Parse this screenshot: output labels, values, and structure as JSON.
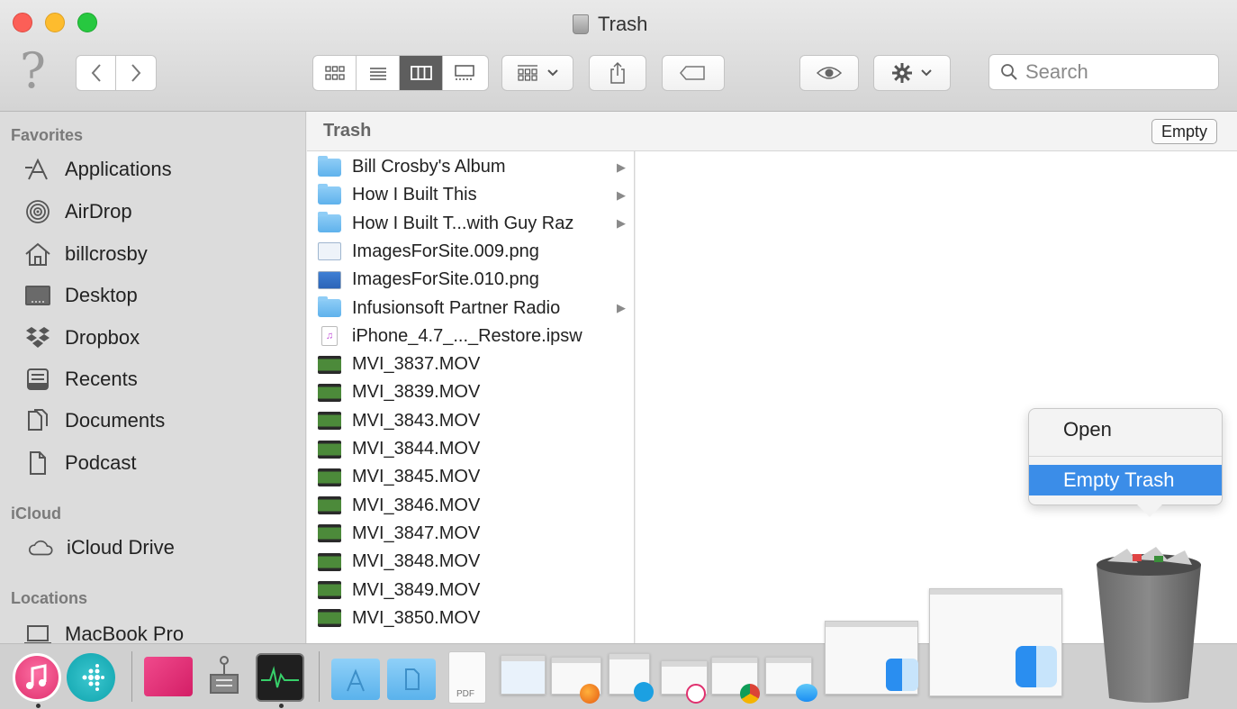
{
  "window": {
    "title": "Trash",
    "help_glyph": "?"
  },
  "toolbar": {
    "back_icon": "chevron-left-icon",
    "forward_icon": "chevron-right-icon",
    "view_modes": [
      "icon-view-icon",
      "list-view-icon",
      "column-view-icon",
      "gallery-view-icon"
    ],
    "active_view": "column-view-icon",
    "search_placeholder": "Search"
  },
  "sidebar": {
    "sections": [
      {
        "label": "Favorites"
      },
      {
        "label": "iCloud"
      },
      {
        "label": "Locations"
      }
    ],
    "favorites": [
      {
        "label": "Applications",
        "icon": "applications-icon"
      },
      {
        "label": "AirDrop",
        "icon": "airdrop-icon"
      },
      {
        "label": "billcrosby",
        "icon": "home-icon"
      },
      {
        "label": "Desktop",
        "icon": "desktop-icon"
      },
      {
        "label": "Dropbox",
        "icon": "dropbox-icon"
      },
      {
        "label": "Recents",
        "icon": "recents-icon"
      },
      {
        "label": "Documents",
        "icon": "documents-icon"
      },
      {
        "label": "Podcast",
        "icon": "document-icon"
      }
    ],
    "icloud": [
      {
        "label": "iCloud Drive",
        "icon": "cloud-icon"
      }
    ],
    "locations": [
      {
        "label": "MacBook Pro",
        "icon": "laptop-icon"
      }
    ]
  },
  "content": {
    "title": "Trash",
    "empty_label": "Empty",
    "files": [
      {
        "name": "Bill Crosby's Album",
        "type": "folder",
        "has_children": true
      },
      {
        "name": "How I Built This",
        "type": "folder",
        "has_children": true
      },
      {
        "name": "How I Built T...with Guy Raz",
        "type": "folder",
        "has_children": true
      },
      {
        "name": "ImagesForSite.009.png",
        "type": "png",
        "has_children": false
      },
      {
        "name": "ImagesForSite.010.png",
        "type": "png2",
        "has_children": false
      },
      {
        "name": "Infusionsoft Partner Radio",
        "type": "folder",
        "has_children": true
      },
      {
        "name": "iPhone_4.7_..._Restore.ipsw",
        "type": "ipsw",
        "has_children": false
      },
      {
        "name": "MVI_3837.MOV",
        "type": "mov",
        "has_children": false
      },
      {
        "name": "MVI_3839.MOV",
        "type": "mov",
        "has_children": false
      },
      {
        "name": "MVI_3843.MOV",
        "type": "mov",
        "has_children": false
      },
      {
        "name": "MVI_3844.MOV",
        "type": "mov",
        "has_children": false
      },
      {
        "name": "MVI_3845.MOV",
        "type": "mov",
        "has_children": false
      },
      {
        "name": "MVI_3846.MOV",
        "type": "mov",
        "has_children": false
      },
      {
        "name": "MVI_3847.MOV",
        "type": "mov",
        "has_children": false
      },
      {
        "name": "MVI_3848.MOV",
        "type": "mov",
        "has_children": false
      },
      {
        "name": "MVI_3849.MOV",
        "type": "mov",
        "has_children": false
      },
      {
        "name": "MVI_3850.MOV",
        "type": "mov",
        "has_children": false
      }
    ]
  },
  "context_menu": {
    "items": [
      {
        "label": "Open",
        "highlighted": false
      },
      {
        "label": "Empty Trash",
        "highlighted": true
      }
    ]
  },
  "dock": {
    "apps": [
      "itunes-icon",
      "fitbit-icon",
      "parallels-icon",
      "system-preferences-icon",
      "activity-monitor-icon",
      "applications-folder-icon",
      "documents-folder-icon",
      "pdf-file-icon",
      "keynote-window-thumbnail",
      "firefox-window-thumbnail",
      "skype-window-thumbnail",
      "itunes-window-thumbnail",
      "chrome-window-thumbnail",
      "messages-window-thumbnail",
      "finder-window-thumbnail",
      "finder-window-thumbnail-2",
      "trash-icon"
    ],
    "pdf_label": "PDF",
    "colors": {
      "accent": "#3b8de8",
      "folder": "#6cb9ee"
    }
  }
}
